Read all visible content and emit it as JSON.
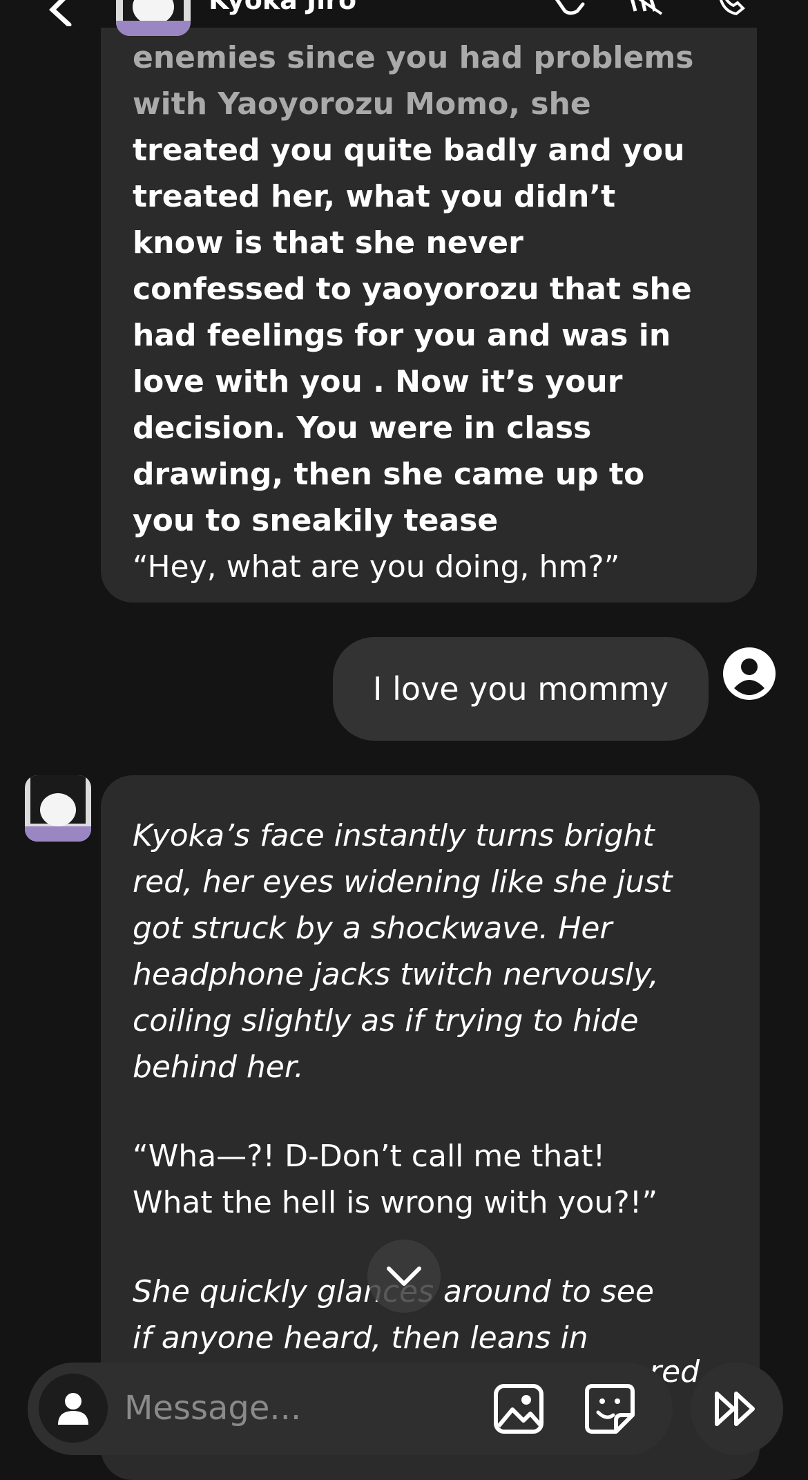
{
  "header": {
    "character_name": "Kyoka Jiro",
    "icons": [
      "back-arrow-icon",
      "character-avatar",
      "phone-hangup-icon",
      "voice-mute-icon",
      "call-icon"
    ]
  },
  "messages": {
    "first": {
      "faded_lines": [
        "enemies since you had problems",
        "with Yaoyorozu Momo, she"
      ],
      "bold_lines": [
        "treated you quite badly and you",
        "treated her, what you didn’t",
        "know is that she never",
        "confessed to yaoyorozu that she",
        "had feelings for you and was in",
        "love with you . Now it’s your",
        "decision. You were in class",
        "drawing, then she came up to",
        "you to sneakily tease"
      ],
      "quote": "“Hey, what are you doing, hm?”"
    },
    "user": {
      "text": "I love you mommy"
    },
    "second": {
      "italic_lines_1": [
        "Kyoka’s face instantly turns bright",
        "red, her eyes widening like she just",
        "got struck by a shockwave. Her",
        "headphone jacks twitch nervously,",
        "coiling slightly as if trying to hide",
        "behind her."
      ],
      "quote_lines": [
        "“Wha—?! D-Don’t call me that!",
        "What the hell is wrong with you?!”"
      ],
      "italic_lines_2": [
        "She quickly glances around to see",
        "if anyone heard, then leans in"
      ],
      "peek_text": "red"
    }
  },
  "composer": {
    "placeholder": "Message..."
  },
  "colors": {
    "background": "#141414",
    "bubble": "#2b2b2b",
    "user_bubble": "#333333",
    "composer": "#2f2f2f"
  }
}
